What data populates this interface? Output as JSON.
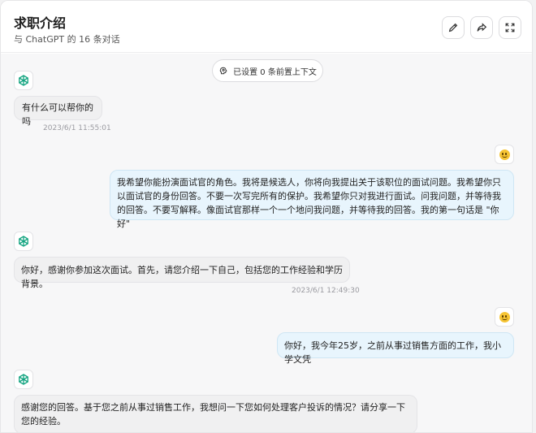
{
  "header": {
    "title": "求职介绍",
    "subtitle": "与 ChatGPT 的 16 条对话",
    "buttons": [
      {
        "name": "edit",
        "icon": "pencil-icon"
      },
      {
        "name": "share",
        "icon": "share-icon"
      },
      {
        "name": "fullscreen",
        "icon": "expand-icon"
      }
    ]
  },
  "context_pill": {
    "label": "已设置 0 条前置上下文",
    "icon": "brain-icon"
  },
  "messages": [
    {
      "role": "bot",
      "text": "有什么可以帮你的吗",
      "time": "2023/6/1 11:55:01"
    },
    {
      "role": "user",
      "text": "我希望你能扮演面试官的角色。我将是候选人，你将向我提出关于该职位的面试问题。我希望你只以面试官的身份回答。不要一次写完所有的保护。我希望你只对我进行面试。问我问题，并等待我的回答。不要写解释。像面试官那样一个一个地问我问题，并等待我的回答。我的第一句话是 \"你好\""
    },
    {
      "role": "bot",
      "text": "你好，感谢你参加这次面试。首先，请您介绍一下自己，包括您的工作经验和学历背景。",
      "time": "2023/6/1 12:49:30"
    },
    {
      "role": "user",
      "text": "你好，我今年25岁，之前从事过销售方面的工作，我小学文凭"
    },
    {
      "role": "bot",
      "text": "感谢您的回答。基于您之前从事过销售工作，我想问一下您如何处理客户投诉的情况？请分享一下您的经验。"
    }
  ],
  "colors": {
    "bot_icon": "#10a37f",
    "user_bubble": "#e8f5fd",
    "emoji": "#f6c433"
  }
}
